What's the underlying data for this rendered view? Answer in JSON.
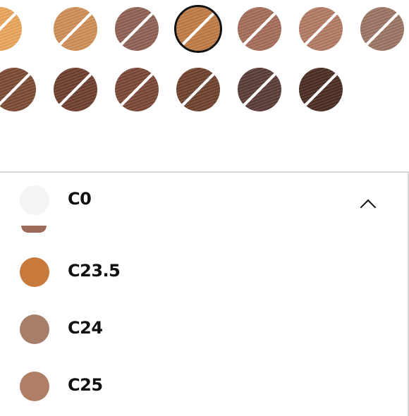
{
  "swatches": {
    "row1": [
      "#e9a55b",
      "#cf8e55",
      "#8e6153",
      "#c07a43",
      "#a46c58",
      "#b27a62",
      "#9b7463"
    ],
    "row2": [
      "#7a4a33",
      "#6d3d2d",
      "#7a4636",
      "#6e412d",
      "#5a3b35",
      "#4a2b22"
    ],
    "selected_index": 3
  },
  "dropdown": {
    "selected": {
      "label": "C0",
      "color": "#f4f4f4"
    },
    "partial_color": "#9b6a58",
    "options": [
      {
        "label": "C23.5",
        "color": "#c87a3c"
      },
      {
        "label": "C24",
        "color": "#a77e6a"
      },
      {
        "label": "C25",
        "color": "#b07e67"
      }
    ]
  }
}
